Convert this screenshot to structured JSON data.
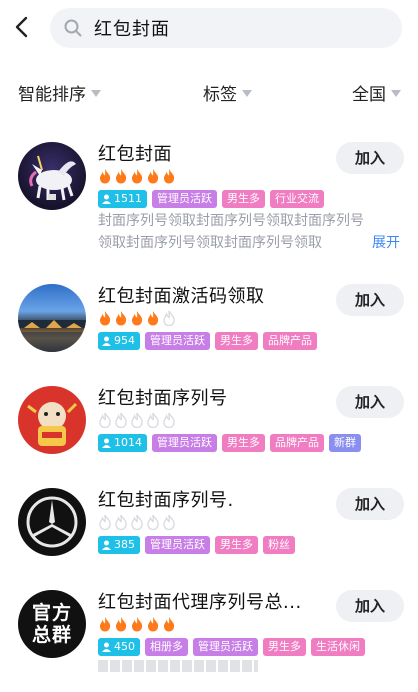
{
  "search": {
    "query": "红包封面"
  },
  "filters": [
    {
      "label": "智能排序"
    },
    {
      "label": "标签"
    },
    {
      "label": "全国"
    }
  ],
  "colors": {
    "accent_blue": "#3e86f5",
    "flame": "#ff7a1a",
    "flame_empty": "#d6d9de"
  },
  "groups": [
    {
      "title": "红包封面",
      "flames_active": 5,
      "flames_total": 5,
      "tags": [
        "1511",
        "管理员活跃",
        "男生多",
        "行业交流"
      ],
      "desc_line1": "封面序列号领取封面序列号领取封面序列号",
      "desc_line2": "领取封面序列号领取封面序列号领取",
      "expand": "展开",
      "join": "加入"
    },
    {
      "title": "红包封面激活码领取",
      "flames_active": 4,
      "flames_total": 5,
      "tags": [
        "954",
        "管理员活跃",
        "男生多",
        "品牌产品"
      ],
      "join": "加入"
    },
    {
      "title": "红包封面序列号",
      "flames_active": 0,
      "flames_total": 5,
      "tags": [
        "1014",
        "管理员活跃",
        "男生多",
        "品牌产品",
        "新群"
      ],
      "join": "加入"
    },
    {
      "title": "红包封面序列号.",
      "flames_active": 0,
      "flames_total": 5,
      "tags": [
        "385",
        "管理员活跃",
        "男生多",
        "粉丝"
      ],
      "join": "加入"
    },
    {
      "title": "红包封面代理序列号总...",
      "flames_active": 5,
      "flames_total": 5,
      "tags": [
        "450",
        "相册多",
        "管理员活跃",
        "男生多",
        "生活休闲"
      ],
      "avatar_text_line1": "官方",
      "avatar_text_line2": "总群",
      "join": "加入"
    }
  ]
}
